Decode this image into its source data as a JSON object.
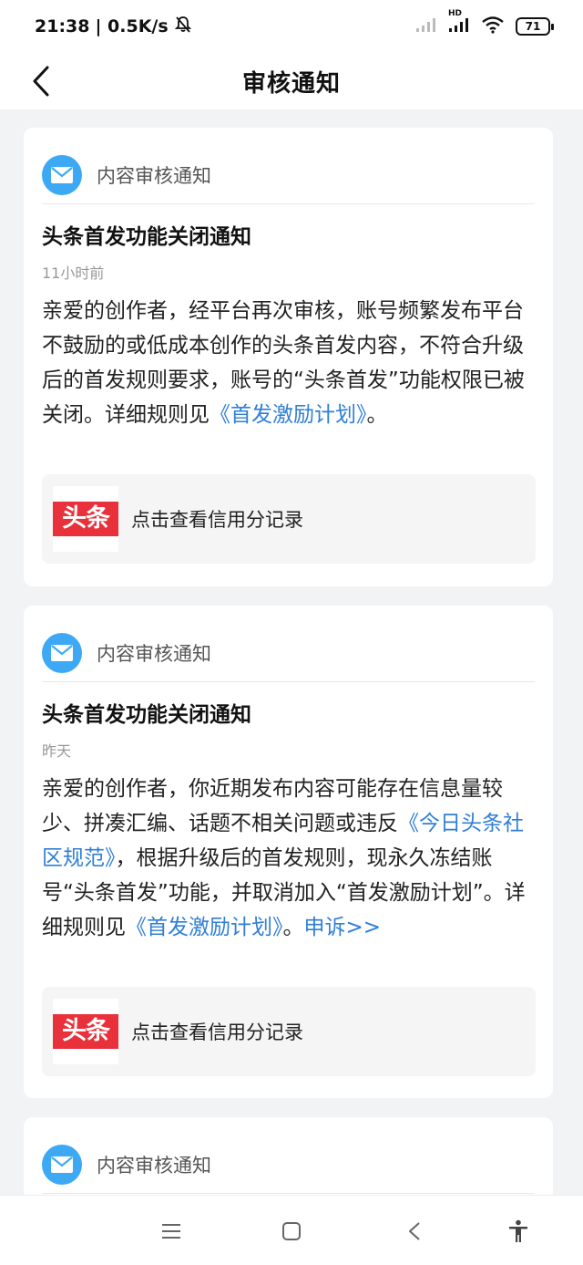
{
  "status_bar": {
    "time": "21:38",
    "speed": "| 0.5K/s",
    "network_label": "HD",
    "battery": "71"
  },
  "header": {
    "title": "审核通知"
  },
  "cards": [
    {
      "category": "内容审核通知",
      "title": "头条首发功能关闭通知",
      "time": "11小时前",
      "body_parts": [
        "亲爱的创作者，经平台再次审核，账号频繁发布平台不鼓励的或低成本创作的头条首发内容，不符合升级后的首发规则要求，账号的“头条首发”功能权限已被关闭。详细规则见",
        "《首发激励计划》",
        "。"
      ],
      "credit_logo": "头条",
      "credit_label": "点击查看信用分记录"
    },
    {
      "category": "内容审核通知",
      "title": "头条首发功能关闭通知",
      "time": "昨天",
      "body_parts": [
        "亲爱的创作者，你近期发布内容可能存在信息量较少、拼凑汇编、话题不相关问题或违反",
        "《今日头条社区规范》",
        "，根据升级后的首发规则，现永久冻结账号“头条首发”功能，并取消加入“首发激励计划”。详细规则见",
        "《首发激励计划》",
        "。",
        "申诉>>"
      ],
      "credit_logo": "头条",
      "credit_label": "点击查看信用分记录"
    },
    {
      "category": "内容审核通知"
    }
  ],
  "colors": {
    "accent": "#3da9f5",
    "link": "#2f7fd6",
    "logo_red": "#e8313a",
    "background": "#f2f3f5"
  },
  "icons": {
    "back": "chevron-left-icon",
    "mail": "mail-icon",
    "sys_menu": "menu-icon",
    "sys_home": "home-square-icon",
    "sys_back": "back-triangle-icon",
    "sys_accessibility": "accessibility-icon"
  }
}
